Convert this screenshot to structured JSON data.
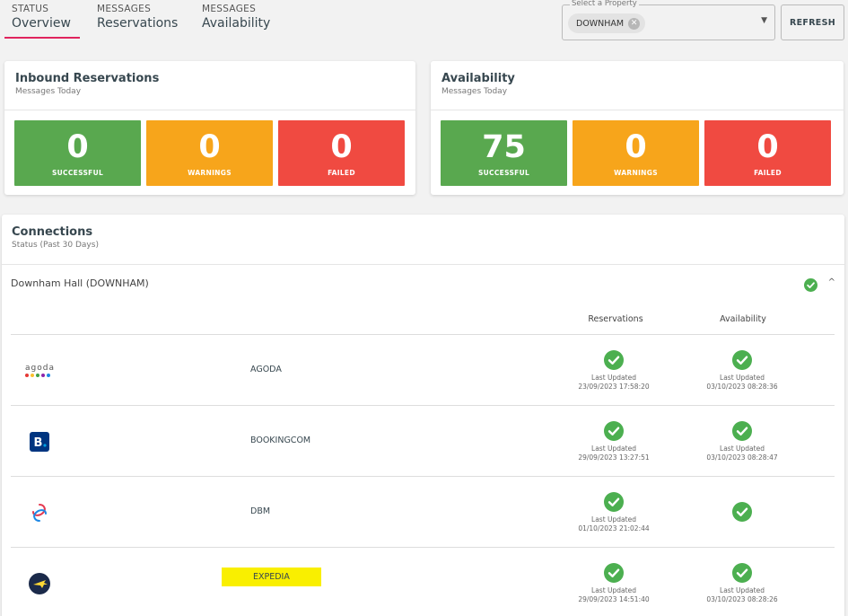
{
  "nav": {
    "tabs": [
      {
        "category": "STATUS",
        "name": "Overview"
      },
      {
        "category": "MESSAGES",
        "name": "Reservations"
      },
      {
        "category": "MESSAGES",
        "name": "Availability"
      }
    ]
  },
  "property_select": {
    "legend": "Select a Property",
    "selected": "DOWNHAM"
  },
  "refresh_label": "REFRESH",
  "inbound": {
    "title": "Inbound Reservations",
    "subtitle": "Messages Today",
    "tiles": [
      {
        "value": "0",
        "label": "SUCCESSFUL",
        "color": "#59a84f"
      },
      {
        "value": "0",
        "label": "WARNINGS",
        "color": "#f7a51b"
      },
      {
        "value": "0",
        "label": "FAILED",
        "color": "#f04a41"
      }
    ]
  },
  "availability": {
    "title": "Availability",
    "subtitle": "Messages Today",
    "tiles": [
      {
        "value": "75",
        "label": "SUCCESSFUL",
        "color": "#59a84f"
      },
      {
        "value": "0",
        "label": "WARNINGS",
        "color": "#f7a51b"
      },
      {
        "value": "0",
        "label": "FAILED",
        "color": "#f04a41"
      }
    ]
  },
  "connections": {
    "title": "Connections",
    "subtitle": "Status (Past 30 Days)",
    "property_name": "Downham Hall (DOWNHAM)",
    "columns": {
      "reservations": "Reservations",
      "availability": "Availability"
    },
    "rows": [
      {
        "channel": "AGODA",
        "logo": "agoda-logo",
        "res_label": "Last Updated",
        "res_time": "23/09/2023 17:58:20",
        "avail_label": "Last Updated",
        "avail_time": "03/10/2023 08:28:36"
      },
      {
        "channel": "BOOKINGCOM",
        "logo": "booking-logo",
        "res_label": "Last Updated",
        "res_time": "29/09/2023 13:27:51",
        "avail_label": "Last Updated",
        "avail_time": "03/10/2023 08:28:47"
      },
      {
        "channel": "DBM",
        "logo": "dbm-logo",
        "res_label": "Last Updated",
        "res_time": "01/10/2023 21:02:44",
        "avail_label": "",
        "avail_time": ""
      },
      {
        "channel": "EXPEDIA",
        "logo": "expedia-logo",
        "res_label": "Last Updated",
        "res_time": "29/09/2023 14:51:40",
        "avail_label": "Last Updated",
        "avail_time": "03/10/2023 08:28:26"
      }
    ],
    "check_color": "#4caf50"
  }
}
